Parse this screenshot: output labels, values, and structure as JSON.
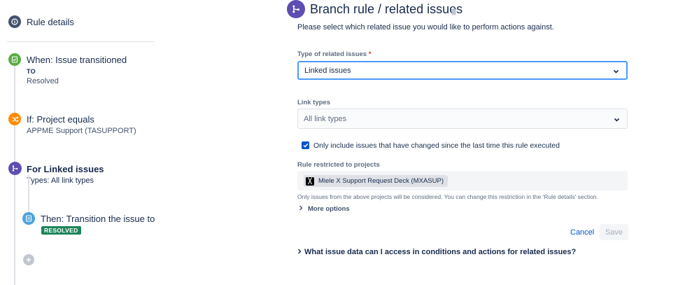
{
  "sidebar": {
    "rule_details_label": "Rule details",
    "trigger": {
      "title": "When: Issue transitioned",
      "to_label": "TO",
      "to_value": "Resolved",
      "color": "#5aac44"
    },
    "condition": {
      "title": "If: Project equals",
      "value": "APPME Support (TASUPPORT)",
      "color": "#ff8b00"
    },
    "branch": {
      "title": "For Linked issues",
      "value": "Types: All link types",
      "color": "#5e4db2"
    },
    "action": {
      "title": "Then: Transition the issue to",
      "status": "RESOLVED",
      "color": "#4ca3dd"
    },
    "icons": [
      "info-icon",
      "trigger-icon",
      "condition-shuffle-icon",
      "branch-icon",
      "action-icon",
      "add-component-icon"
    ]
  },
  "main": {
    "title": "Branch rule / related issues",
    "description": "Please select which related issue you would like to perform actions against.",
    "related_type": {
      "label": "Type of related issues",
      "required_mark": "*",
      "value": "Linked issues"
    },
    "link_types": {
      "label": "Link types",
      "value": "All link types"
    },
    "only_changed": {
      "checked": true,
      "label": "Only include issues that have changed since the last time this rule executed"
    },
    "restricted": {
      "label": "Rule restricted to projects",
      "project": "Miele X Support Request Deck (MXASUP)",
      "hint": "Only issues from the above projects will be considered. You can change this restriction in the 'Rule details' section."
    },
    "more_options": "More options",
    "cancel_label": "Cancel",
    "save_label": "Save",
    "faq": "What issue data can I access in conditions and actions for related issues?"
  },
  "colors": {
    "accent": "#0052cc",
    "focus": "#4c9aff",
    "branch_purple": "#5e4db2",
    "status_green": "#1f845a"
  }
}
